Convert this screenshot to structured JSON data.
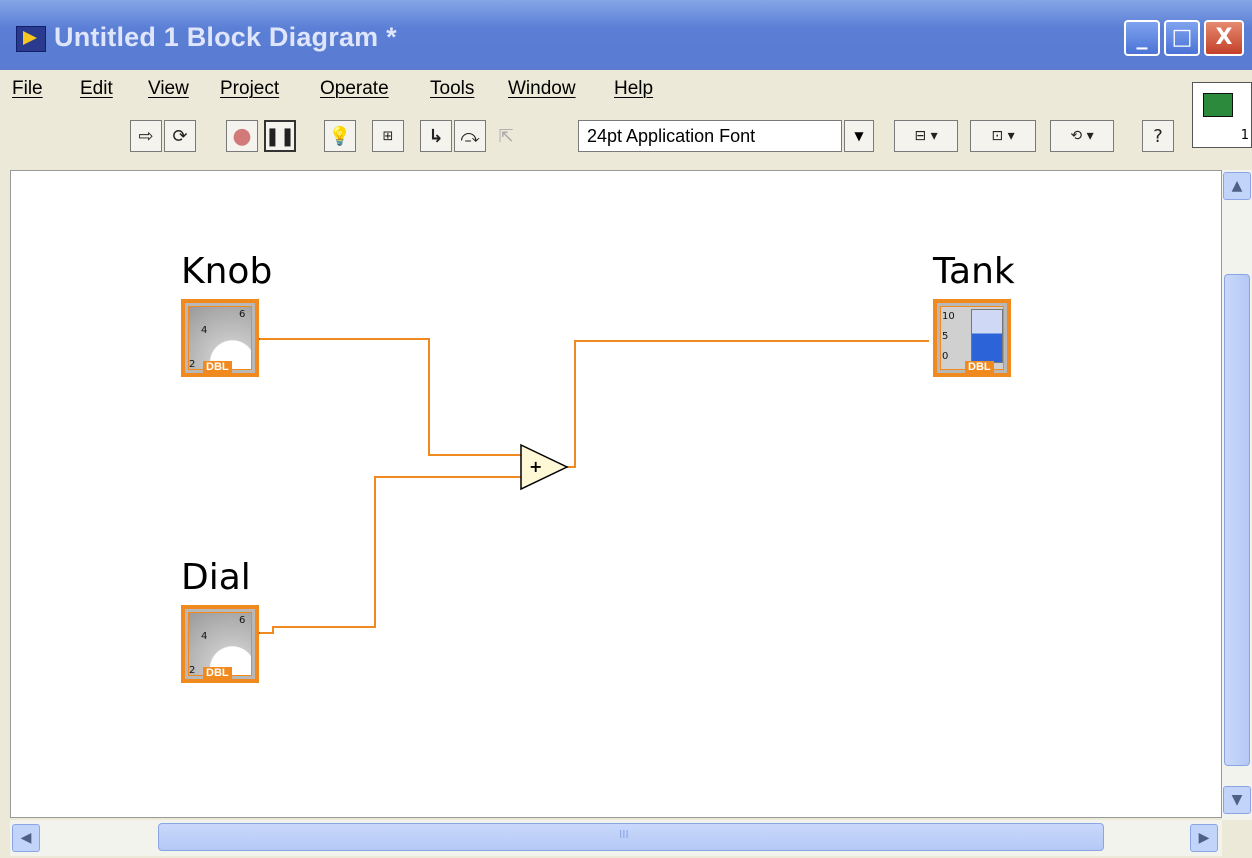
{
  "window": {
    "title": "Untitled 1 Block Diagram *",
    "buttons": {
      "minimize": "_",
      "maximize": "□",
      "close": "X"
    }
  },
  "menu": [
    "File",
    "Edit",
    "View",
    "Project",
    "Operate",
    "Tools",
    "Window",
    "Help"
  ],
  "toolbar": {
    "font_select": "24pt Application Font",
    "icons": [
      "run-arrow-icon",
      "run-continuous-icon",
      "abort-icon",
      "pause-icon",
      "highlight-bulb-icon",
      "retain-wire-icon",
      "step-into-icon",
      "step-over-icon",
      "step-out-icon",
      "align-icon",
      "distribute-icon",
      "reorder-icon",
      "help-icon"
    ]
  },
  "vi_icon": {
    "number": "1"
  },
  "diagram": {
    "nodes": [
      {
        "label": "Knob",
        "type": "DBL",
        "scale": [
          "4",
          "6",
          "2"
        ]
      },
      {
        "label": "Dial",
        "type": "DBL",
        "scale": [
          "4",
          "6",
          "2"
        ]
      },
      {
        "label": "Tank",
        "type": "DBL",
        "scale": [
          "10",
          "5",
          "0"
        ]
      }
    ],
    "add_function_symbol": "+"
  },
  "scroll": {
    "grip": "III"
  }
}
